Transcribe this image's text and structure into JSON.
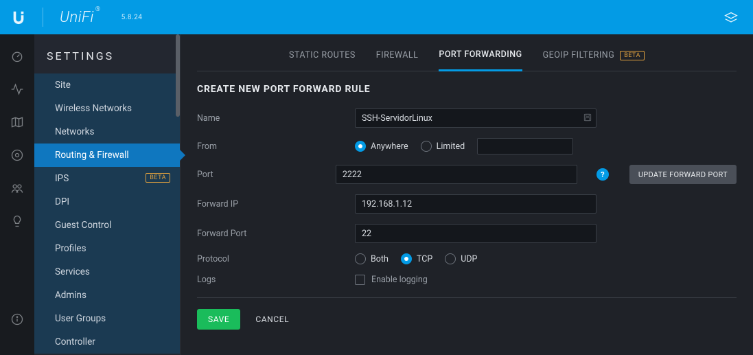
{
  "header": {
    "brand": "UniFi",
    "version": "5.8.24",
    "right_icon": "layers-icon"
  },
  "rail": {
    "icons": [
      {
        "name": "dashboard-icon"
      },
      {
        "name": "activity-icon"
      },
      {
        "name": "map-icon"
      },
      {
        "name": "devices-icon"
      },
      {
        "name": "clients-icon"
      },
      {
        "name": "insights-icon"
      }
    ],
    "bottom_icon": "info-icon"
  },
  "sidebar": {
    "title": "SETTINGS",
    "items": [
      {
        "label": "Site"
      },
      {
        "label": "Wireless Networks"
      },
      {
        "label": "Networks"
      },
      {
        "label": "Routing & Firewall",
        "active": true
      },
      {
        "label": "IPS",
        "badge": "BETA"
      },
      {
        "label": "DPI"
      },
      {
        "label": "Guest Control"
      },
      {
        "label": "Profiles"
      },
      {
        "label": "Services"
      },
      {
        "label": "Admins"
      },
      {
        "label": "User Groups"
      },
      {
        "label": "Controller"
      }
    ]
  },
  "tabs": [
    {
      "label": "STATIC ROUTES"
    },
    {
      "label": "FIREWALL"
    },
    {
      "label": "PORT FORWARDING",
      "active": true
    },
    {
      "label": "GEOIP FILTERING",
      "badge": "BETA"
    }
  ],
  "form": {
    "title": "CREATE NEW PORT FORWARD RULE",
    "labels": {
      "name": "Name",
      "from": "From",
      "port": "Port",
      "forward_ip": "Forward IP",
      "forward_port": "Forward Port",
      "protocol": "Protocol",
      "logs": "Logs"
    },
    "values": {
      "name": "SSH-ServidorLinux",
      "port": "2222",
      "forward_ip": "192.168.1.12",
      "forward_port": "22"
    },
    "from": {
      "options": {
        "anywhere": "Anywhere",
        "limited": "Limited"
      },
      "selected": "anywhere"
    },
    "protocol": {
      "options": {
        "both": "Both",
        "tcp": "TCP",
        "udp": "UDP"
      },
      "selected": "tcp"
    },
    "logs": {
      "label": "Enable logging",
      "checked": false
    },
    "help_char": "?",
    "update_button": "UPDATE FORWARD PORT",
    "save_button": "SAVE",
    "cancel_button": "CANCEL"
  }
}
